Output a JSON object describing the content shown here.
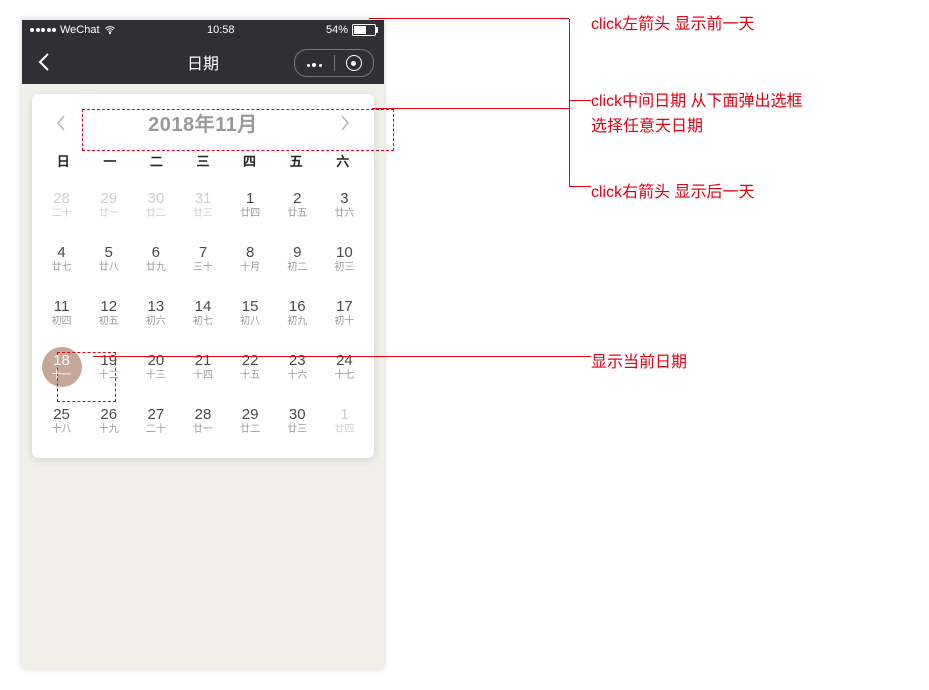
{
  "statusbar": {
    "carrier": "WeChat",
    "time": "10:58",
    "battery_pct": "54%"
  },
  "navbar": {
    "title": "日期"
  },
  "calendar": {
    "month_title": "2018年11月",
    "weekdays": [
      "日",
      "一",
      "二",
      "三",
      "四",
      "五",
      "六"
    ],
    "days": [
      [
        {
          "n": "28",
          "s": "二十",
          "muted": true
        },
        {
          "n": "29",
          "s": "廿一",
          "muted": true
        },
        {
          "n": "30",
          "s": "廿二",
          "muted": true
        },
        {
          "n": "31",
          "s": "廿三",
          "muted": true
        },
        {
          "n": "1",
          "s": "廿四"
        },
        {
          "n": "2",
          "s": "廿五"
        },
        {
          "n": "3",
          "s": "廿六"
        }
      ],
      [
        {
          "n": "4",
          "s": "廿七"
        },
        {
          "n": "5",
          "s": "廿八"
        },
        {
          "n": "6",
          "s": "廿九"
        },
        {
          "n": "7",
          "s": "三十"
        },
        {
          "n": "8",
          "s": "十月"
        },
        {
          "n": "9",
          "s": "初二"
        },
        {
          "n": "10",
          "s": "初三"
        }
      ],
      [
        {
          "n": "11",
          "s": "初四"
        },
        {
          "n": "12",
          "s": "初五"
        },
        {
          "n": "13",
          "s": "初六"
        },
        {
          "n": "14",
          "s": "初七"
        },
        {
          "n": "15",
          "s": "初八"
        },
        {
          "n": "16",
          "s": "初九"
        },
        {
          "n": "17",
          "s": "初十"
        }
      ],
      [
        {
          "n": "18",
          "s": "十一",
          "today": true
        },
        {
          "n": "19",
          "s": "十二"
        },
        {
          "n": "20",
          "s": "十三"
        },
        {
          "n": "21",
          "s": "十四"
        },
        {
          "n": "22",
          "s": "十五"
        },
        {
          "n": "23",
          "s": "十六"
        },
        {
          "n": "24",
          "s": "十七"
        }
      ],
      [
        {
          "n": "25",
          "s": "十八"
        },
        {
          "n": "26",
          "s": "十九"
        },
        {
          "n": "27",
          "s": "二十"
        },
        {
          "n": "28",
          "s": "廿一"
        },
        {
          "n": "29",
          "s": "廿二"
        },
        {
          "n": "30",
          "s": "廿三"
        },
        {
          "n": "1",
          "s": "廿四",
          "muted": true
        }
      ]
    ]
  },
  "annotations": {
    "a1": "click左箭头 显示前一天",
    "a2": "click中间日期 从下面弹出选框\n选择任意天日期",
    "a3": "click右箭头 显示后一天",
    "a4": "显示当前日期"
  }
}
